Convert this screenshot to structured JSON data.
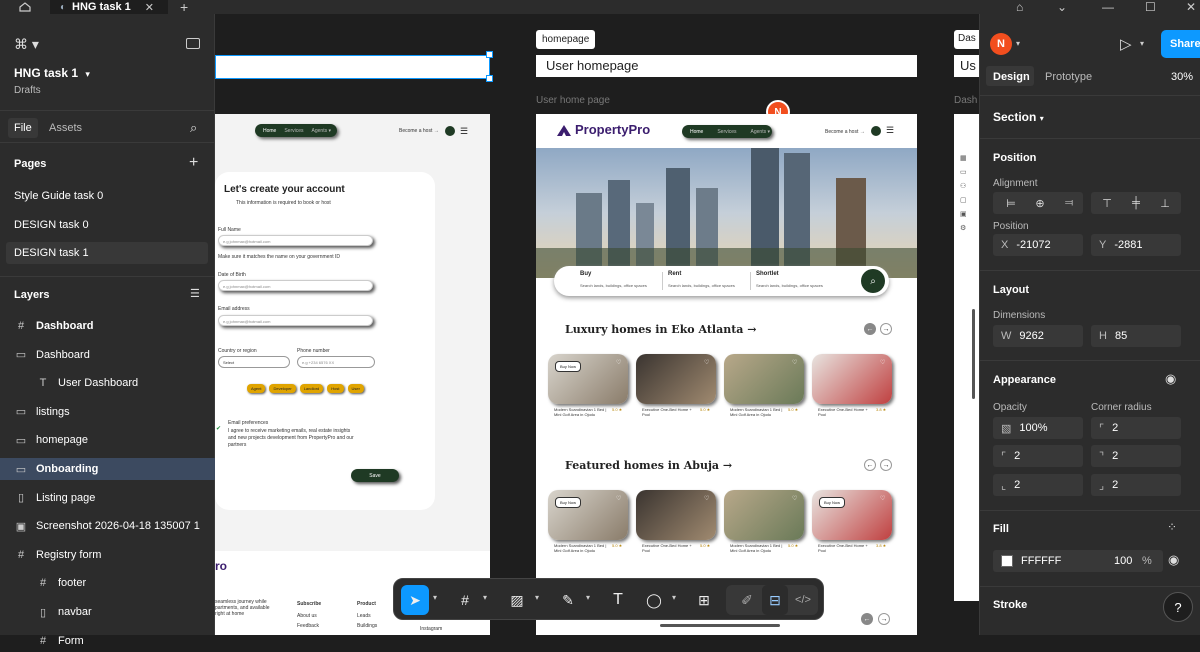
{
  "tabs": {
    "active": "HNG task 1"
  },
  "left": {
    "file": "HNG task 1",
    "drafts": "Drafts",
    "tab_file": "File",
    "tab_assets": "Assets",
    "pages_title": "Pages",
    "pages": [
      "Style Guide task 0",
      "DESIGN task 0",
      "DESIGN task 1"
    ],
    "layers_title": "Layers",
    "layers": [
      {
        "label": "Dashboard",
        "icon": "#",
        "indent": 0,
        "bold": true
      },
      {
        "label": "Dashboard",
        "icon": "▭",
        "indent": 0
      },
      {
        "label": "User Dashboard",
        "icon": "T",
        "indent": 1
      },
      {
        "label": "listings",
        "icon": "▭",
        "indent": 0
      },
      {
        "label": "homepage",
        "icon": "▭",
        "indent": 0
      },
      {
        "label": "Onboarding",
        "icon": "▭",
        "indent": 0,
        "selected": true
      },
      {
        "label": "Listing page",
        "icon": "▯",
        "indent": 0
      },
      {
        "label": "Screenshot 2026-04-18 135007 1",
        "icon": "▣",
        "indent": 0
      },
      {
        "label": "Registry form",
        "icon": "#",
        "indent": 0
      },
      {
        "label": "footer",
        "icon": "#",
        "indent": 1
      },
      {
        "label": "navbar",
        "icon": "▯",
        "indent": 1
      },
      {
        "label": "Form",
        "icon": "#",
        "indent": 1
      }
    ]
  },
  "canvas": {
    "homepage_tag": "homepage",
    "homepage_title": "User homepage",
    "frame_label": "User home page",
    "right_tag": "Das",
    "right_title": "Us",
    "right_frame_label": "Dash",
    "avatar_letter": "N",
    "signup": {
      "nav": [
        "Home",
        "Services",
        "Agents ▾"
      ],
      "become_host": "Become a host →",
      "heading": "Let's create your account",
      "sub": "This information is required to book or host",
      "full_name": "Full Name",
      "name_ph": "e.g johnmax@hotmail.com",
      "name_hint": "Make sure it matches the name on your government ID",
      "dob": "Date of Birth",
      "dob_ph": "e.g johnmax@hotmail.com",
      "email": "Email address",
      "email_ph": "e.g johnmax@hotmail.com",
      "country": "Country or region",
      "country_val": "Select",
      "phone": "Phone number",
      "phone_ph": "e.g +234 6576 XX",
      "roles": [
        "Agent",
        "Developer",
        "Landlord",
        "Host",
        "User"
      ],
      "email_pref_title": "Email preferences",
      "email_pref": "I agree to receive marketing emails, real estate insights and new projects development from PropertyPro and our partners",
      "save": "Save",
      "footer_logo": "ro",
      "footer_text": "seamless journey while partments, and available right at home",
      "subscribe": "Subscribe",
      "product": "Product",
      "about": "About us",
      "leads": "Leads",
      "feedback": "Feedback",
      "buildings": "Buildings",
      "instagram": "Instagram"
    },
    "home": {
      "logo": "PropertyPro",
      "nav": [
        "Home",
        "Services",
        "Agents ▾"
      ],
      "become_host": "Become a host →",
      "search": [
        {
          "title": "Buy",
          "sub": "Search lands, buildings, office spaces"
        },
        {
          "title": "Rent",
          "sub": "Search lands, buildings, office spaces"
        },
        {
          "title": "Shortlet",
          "sub": "Search lands, buildings, office spaces"
        }
      ],
      "section1": "Luxury homes in Eko Atlanta →",
      "section2": "Featured homes in Abuja →",
      "buy_now": "Buy Now",
      "cards": [
        {
          "title": "Modern Scandinavian 1 Bed | Mini Golf Area in Ojodu",
          "rating": "5.0 ★"
        },
        {
          "title": "Executive One-Bed Home + Pool",
          "rating": "5.0 ★"
        },
        {
          "title": "Modern Scandinavian 1 Bed | Mini Golf Area in Ojodu",
          "rating": "5.0 ★"
        },
        {
          "title": "Executive One-Bed Home + Pool",
          "rating": "3.8 ★"
        }
      ]
    }
  },
  "right": {
    "avatar": "N",
    "share": "Share",
    "tab_design": "Design",
    "tab_prototype": "Prototype",
    "zoom": "30%",
    "section": "Section",
    "position": "Position",
    "alignment": "Alignment",
    "position_label": "Position",
    "x_label": "X",
    "x_value": "-21072",
    "y_label": "Y",
    "y_value": "-2881",
    "layout": "Layout",
    "dimensions": "Dimensions",
    "w_label": "W",
    "w_value": "9262",
    "h_label": "H",
    "h_value": "85",
    "appearance": "Appearance",
    "opacity_label": "Opacity",
    "corner_label": "Corner radius",
    "opacity": "100%",
    "radius": "2",
    "fill": "Fill",
    "fill_hex": "FFFFFF",
    "fill_opacity": "100",
    "percent": "%",
    "stroke": "Stroke"
  },
  "colors": {
    "accent": "#0d99ff",
    "selection": "#3c4a60",
    "brand_green": "#1f3a24",
    "brand_purple": "#3b1d6e",
    "avatar_orange": "#f24e1e"
  }
}
